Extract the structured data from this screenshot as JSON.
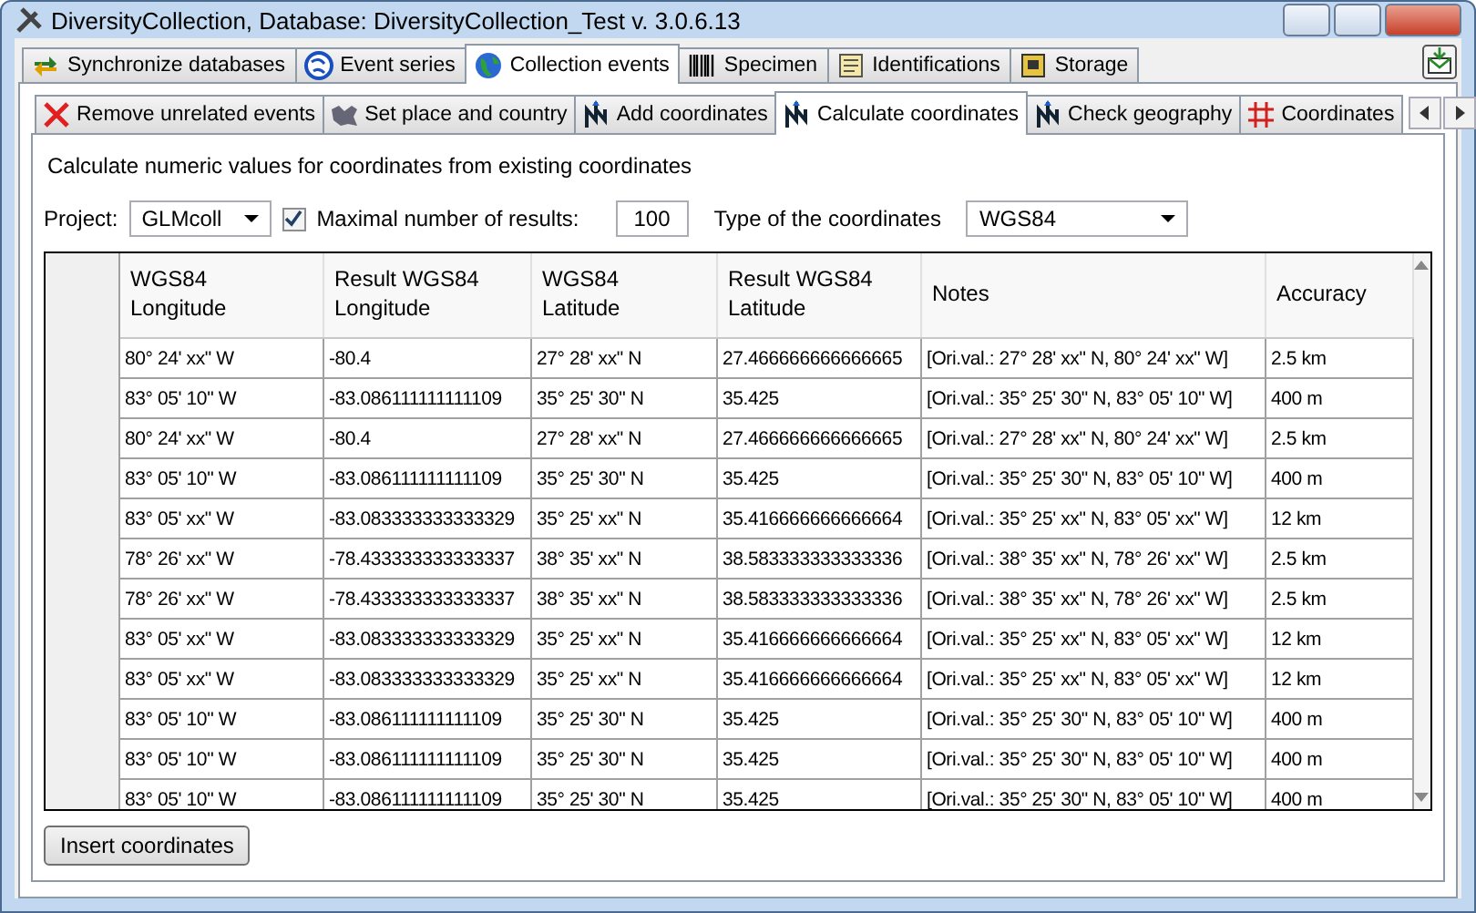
{
  "window": {
    "title": "DiversityCollection,  Database: DiversityCollection_Test   v. 3.0.6.13"
  },
  "main_tabs": [
    {
      "label": "Synchronize databases",
      "selected": false
    },
    {
      "label": "Event series",
      "selected": false
    },
    {
      "label": "Collection events",
      "selected": true
    },
    {
      "label": "Specimen",
      "selected": false
    },
    {
      "label": "Identifications",
      "selected": false
    },
    {
      "label": "Storage",
      "selected": false
    }
  ],
  "sub_tabs": [
    {
      "label": "Remove unrelated events",
      "selected": false
    },
    {
      "label": "Set place and country",
      "selected": false
    },
    {
      "label": "Add coordinates",
      "selected": false
    },
    {
      "label": "Calculate coordinates",
      "selected": true
    },
    {
      "label": "Check geography",
      "selected": false
    },
    {
      "label": "Coordinates",
      "selected": false
    }
  ],
  "description": "Calculate numeric values for coordinates from existing coordinates",
  "project": {
    "label": "Project:",
    "value": "GLMcoll"
  },
  "max_results": {
    "label": "Maximal number of results:",
    "checked": true,
    "value": "100"
  },
  "coord_type": {
    "label": "Type of the coordinates",
    "value": "WGS84"
  },
  "table": {
    "columns": [
      "WGS84\nLongitude",
      "Result WGS84\nLongitude",
      "WGS84\nLatitude",
      "Result WGS84\nLatitude",
      "Notes",
      "Accuracy"
    ],
    "rows": [
      [
        "80° 24' xx\" W",
        "-80.4",
        "27° 28' xx\" N",
        "27.466666666666665",
        "[Ori.val.: 27° 28' xx\" N, 80° 24' xx\" W]",
        "2.5 km"
      ],
      [
        "83° 05' 10\" W",
        "-83.086111111111109",
        "35° 25' 30\" N",
        "35.425",
        "[Ori.val.: 35° 25' 30\" N, 83° 05' 10\" W]",
        "400 m"
      ],
      [
        "80° 24' xx\" W",
        "-80.4",
        "27° 28' xx\" N",
        "27.466666666666665",
        "[Ori.val.: 27° 28' xx\" N, 80° 24' xx\" W]",
        "2.5 km"
      ],
      [
        "83° 05' 10\" W",
        "-83.086111111111109",
        "35° 25' 30\" N",
        "35.425",
        "[Ori.val.: 35° 25' 30\" N, 83° 05' 10\" W]",
        "400 m"
      ],
      [
        "83° 05' xx\" W",
        "-83.083333333333329",
        "35° 25' xx\" N",
        "35.416666666666664",
        "[Ori.val.: 35° 25' xx\" N, 83° 05' xx\" W]",
        "12 km"
      ],
      [
        "78° 26' xx\" W",
        "-78.433333333333337",
        "38° 35' xx\" N",
        "38.583333333333336",
        "[Ori.val.: 38° 35' xx\" N, 78° 26' xx\" W]",
        "2.5 km"
      ],
      [
        "78° 26' xx\" W",
        "-78.433333333333337",
        "38° 35' xx\" N",
        "38.583333333333336",
        "[Ori.val.: 38° 35' xx\" N, 78° 26' xx\" W]",
        "2.5 km"
      ],
      [
        "83° 05' xx\" W",
        "-83.083333333333329",
        "35° 25' xx\" N",
        "35.416666666666664",
        "[Ori.val.: 35° 25' xx\" N, 83° 05' xx\" W]",
        "12 km"
      ],
      [
        "83° 05' xx\" W",
        "-83.083333333333329",
        "35° 25' xx\" N",
        "35.416666666666664",
        "[Ori.val.: 35° 25' xx\" N, 83° 05' xx\" W]",
        "12 km"
      ],
      [
        "83° 05' 10\" W",
        "-83.086111111111109",
        "35° 25' 30\" N",
        "35.425",
        "[Ori.val.: 35° 25' 30\" N, 83° 05' 10\" W]",
        "400 m"
      ],
      [
        "83° 05' 10\" W",
        "-83.086111111111109",
        "35° 25' 30\" N",
        "35.425",
        "[Ori.val.: 35° 25' 30\" N, 83° 05' 10\" W]",
        "400 m"
      ],
      [
        "83° 05' 10\" W",
        "-83.086111111111109",
        "35° 25' 30\" N",
        "35.425",
        "[Ori.val.: 35° 25' 30\" N, 83° 05' 10\" W]",
        "400 m"
      ]
    ]
  },
  "insert_button": "Insert coordinates"
}
